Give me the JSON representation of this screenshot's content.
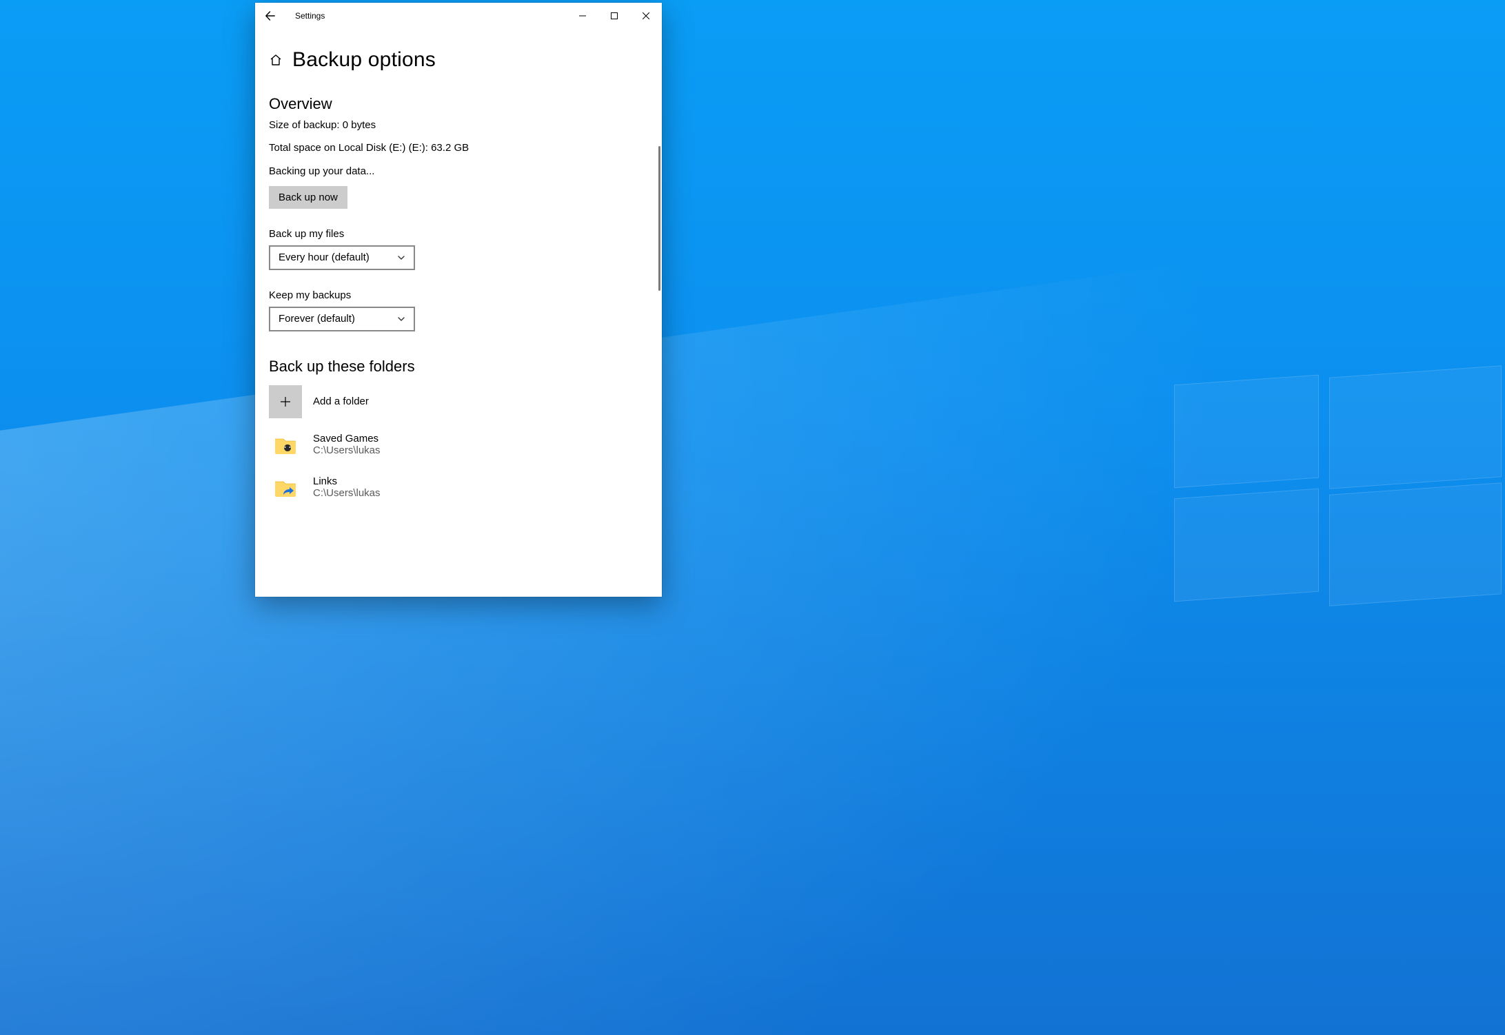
{
  "window": {
    "app_title": "Settings",
    "page_title": "Backup options"
  },
  "overview": {
    "heading": "Overview",
    "size_line": "Size of backup: 0 bytes",
    "space_line": "Total space on Local Disk (E:) (E:): 63.2 GB",
    "status_line": "Backing up your data...",
    "backup_now_label": "Back up now"
  },
  "frequency": {
    "label": "Back up my files",
    "value": "Every hour (default)"
  },
  "retention": {
    "label": "Keep my backups",
    "value": "Forever (default)"
  },
  "folders": {
    "heading": "Back up these folders",
    "add_label": "Add a folder",
    "items": [
      {
        "name": "Saved Games",
        "path": "C:\\Users\\lukas",
        "icon": "saved-games"
      },
      {
        "name": "Links",
        "path": "C:\\Users\\lukas",
        "icon": "links"
      }
    ]
  }
}
